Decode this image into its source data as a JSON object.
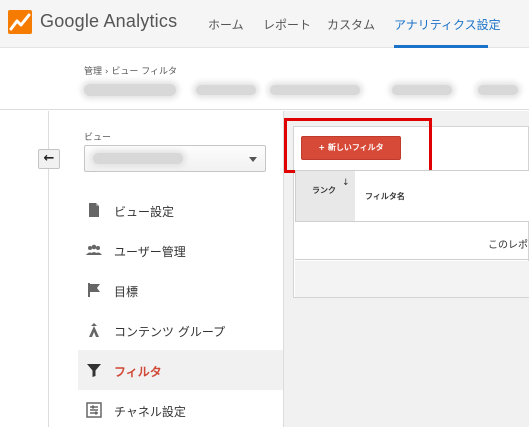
{
  "header": {
    "logo_text": "Google Analytics",
    "nav": [
      {
        "label": "ホーム",
        "active": false
      },
      {
        "label": "レポート",
        "active": false
      },
      {
        "label": "カスタム",
        "active": false
      },
      {
        "label": "アナリティクス設定",
        "active": true
      }
    ]
  },
  "breadcrumb": {
    "root": "管理",
    "separator": "›",
    "current": "ビュー フィルタ"
  },
  "sidebar": {
    "view_label": "ビュー",
    "items": [
      {
        "label": "ビュー設定",
        "icon": "document-icon",
        "active": false
      },
      {
        "label": "ユーザー管理",
        "icon": "users-icon",
        "active": false
      },
      {
        "label": "目標",
        "icon": "flag-icon",
        "active": false
      },
      {
        "label": "コンテンツ グループ",
        "icon": "content-group-icon",
        "active": false
      },
      {
        "label": "フィルタ",
        "icon": "filter-icon",
        "active": true
      },
      {
        "label": "チャネル設定",
        "icon": "channel-settings-icon",
        "active": false
      }
    ]
  },
  "main": {
    "new_filter_button": "+ 新しいフィルタ",
    "table": {
      "headers": [
        "ランク",
        "フィルタ名"
      ],
      "empty_message": "このレポ"
    }
  },
  "colors": {
    "accent_blue": "#1a73c8",
    "button_red": "#d84a38",
    "highlight_red": "#e10000",
    "active_menu_text": "#d14836"
  }
}
